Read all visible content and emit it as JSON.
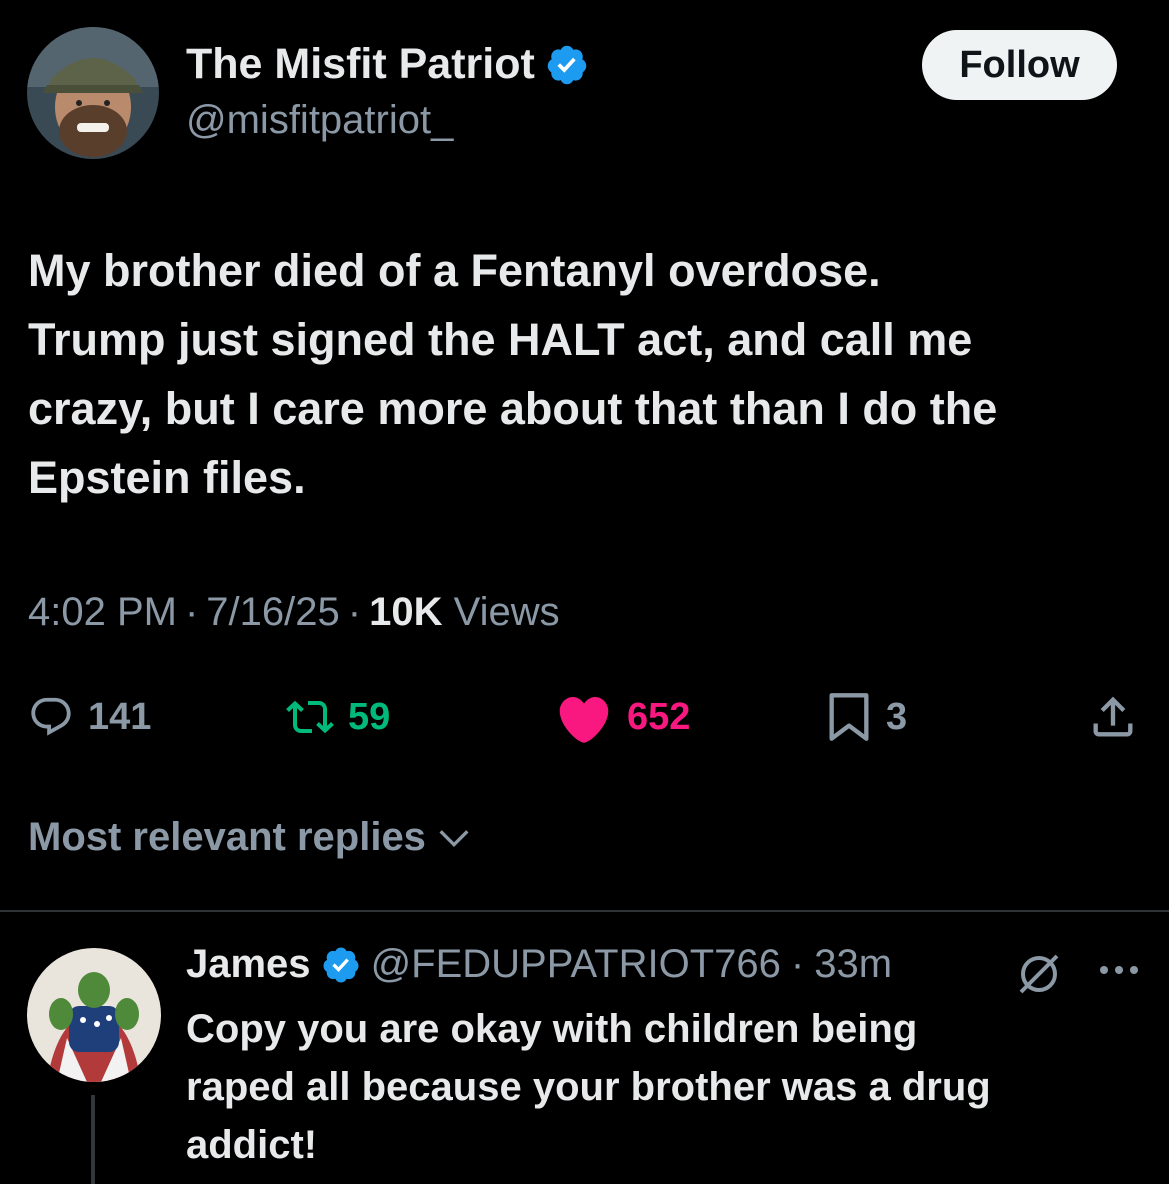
{
  "tweet": {
    "author_name": "The Misfit Patriot",
    "author_handle": "@misfitpatriot_",
    "follow_label": "Follow",
    "text_lines": [
      "My brother died of a Fentanyl overdose.",
      "Trump just signed the HALT act, and call me",
      "crazy, but I care more about that than I do the",
      "Epstein files."
    ],
    "time": "4:02 PM",
    "date": "7/16/25",
    "views_count": "10K",
    "views_label": "Views",
    "separator": "·"
  },
  "actions": {
    "replies": "141",
    "reposts": "59",
    "likes": "652",
    "bookmarks": "3"
  },
  "replies_sort": {
    "label": "Most relevant replies"
  },
  "reply": {
    "name": "James",
    "handle": "@FEDUPPATRIOT766",
    "separator": "·",
    "time": "33m",
    "text_lines": [
      "Copy you are okay with children being",
      "raped all because your brother was a drug",
      "addict!"
    ]
  },
  "colors": {
    "background": "#000000",
    "text_primary": "#e7e9ea",
    "text_secondary": "#8b98a5",
    "verified_blue": "#1d9bf0",
    "repost_green": "#00ba7c",
    "like_pink": "#f91880",
    "follow_button_bg": "#eff3f4"
  },
  "icons": {
    "verified": "verified-badge-icon",
    "reply": "speech-bubble-icon",
    "repost": "repost-arrows-icon",
    "like": "heart-filled-icon",
    "bookmark": "bookmark-icon",
    "share": "upload-share-icon",
    "sort": "chevron-down-icon",
    "grok": "grok-slash-circle-icon",
    "more": "ellipsis-icon"
  }
}
